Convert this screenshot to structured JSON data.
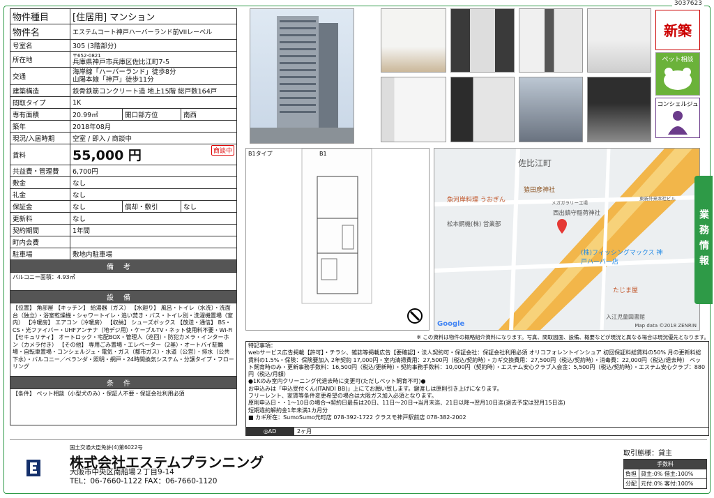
{
  "doc_id": "3037623",
  "spec": {
    "type_k": "物件種目",
    "type_v": "[住居用] マンション",
    "name_k": "物件名",
    "name_v": "エステムコート神戸ハーバーランド前VIIレーベル",
    "room_k": "号室名",
    "room_v": "305 (3階部分)",
    "addr_k": "所在地",
    "addr_zip": "〒652-0821",
    "addr_v": "兵庫県神戸市兵庫区佐比江町7-5",
    "access_k": "交通",
    "access_1": "海岸線「ハーバーランド」徒歩8分",
    "access_2": "山陽本線「神戸」徒歩11分",
    "struct_k": "建築構造",
    "struct_v": "鉄骨鉄筋コンクリート造 地上15階 総戸数164戸",
    "layout_k": "間取タイプ",
    "layout_v": "1K",
    "area_k": "専有面積",
    "area_v": "20.99㎡",
    "dir_k": "開口部方位",
    "dir_v": "南西",
    "built_k": "築年",
    "built_v": "2018年08月",
    "status_k": "現況/入居時期",
    "status_v": "空室 / 即入 / 商談中",
    "rent_k": "賃料",
    "rent_v": "55,000 円",
    "rent_tag": "商談中",
    "fee_k": "共益費・管理費",
    "fee_v": "6,700円",
    "deposit_k": "敷金",
    "deposit_v": "なし",
    "key_k": "礼金",
    "key_v": "なし",
    "guar_k": "保証金",
    "guar_v": "なし",
    "amort_k": "償却・敷引",
    "amort_v": "なし",
    "renew_k": "更新料",
    "renew_v": "なし",
    "term_k": "契約期間",
    "term_v": "1年間",
    "town_k": "町内会費",
    "town_v": "",
    "park_k": "駐車場",
    "park_v": "敷地内駐車場",
    "remarks_h": "備考",
    "remarks_v": "バルコニー面積：4.93㎡",
    "equip_h": "設備",
    "equip_v": "【位置】 角部屋 【キッチン】 給湯器（ガス） 【水廻り】 風呂・トイレ（水洗）・洗面台（独立）・浴室乾燥機・シャワートイレ・追い焚き・バス・トイレ別・洗濯機置場（室内） 【冷暖房】 エアコン（冷暖房） 【収納】 シューズボックス 【放送・通信】 BS・CS・光ファイバー・UHFアンテナ（地デジ用）・ケーブルTV・ネット使用料不要・Wi-Fi 【セキュリティ】 オートロック・宅配BOX・管理人（巡回）・防犯カメラ・インターホン（カメラ付き） 【その他】 専用ごみ置場・エレベーター（2基）・オートバイ駐輪場・自転車置場・コンシェルジュ・電気・ガス（都市ガス）・水道（公営）・排水（公共下水）・バルコニー／ベランダ・照明・網戸・24時間換気システム・分譲タイプ・フローリング",
    "cond_h": "条件",
    "cond_v": "【条件】 ペット相談（小型犬のみ）・保証人不要・保証会社利用必須"
  },
  "badges": {
    "new": "新築",
    "pet": "ペット相談",
    "concierge": "コンシェルジュ"
  },
  "floor_label": "B1タイプ",
  "map": {
    "labels": [
      "佐比江町",
      "猿田彦神社",
      "魚河岸料理 うおぎん",
      "メガガラリー工場",
      "西出鎮守稲荷神社",
      "東新外来本社ビル",
      "松本鋼機(株) 営業部",
      "(株)フィッシングマックス 神戸ハーバー店",
      "たじま屋",
      "入江児童図書館",
      "Google",
      "Map data ©2018 ZENRIN"
    ]
  },
  "note": "※ この資料は物件の概略紹介資料になります。写真、間取図面、設備、概要などが現況と異なる場合は現況優先となります。",
  "tokki": [
    "特記事項：",
    "webサービス広告掲載【許可】・チラシ、雑誌等掲載広告【要確認】・法人契約可・保証会社：保証会社利用必須 オリコフォレントインシュア 初回保証料総賃料の50% 月の更新料総賃料の1.5%・保険：保険要加入 2年契約 17,000円・室内清掃費用：27,500円（税込/契約時）・カギ交換費用：27,500円（税込/契約時）・消毒費：22,000円（税込/退去時） ペット飼育時のみ・更新事務手数料：16,500円（税込/更新時）・契約事務手数料：10,000円（契約時）・エステム安心クラブ入会金：5,500円（税込/契約時）・エステム安心クラブ：880円（税込/月額）",
    "●1Kのみ室内クリーニング代退去時に変更可(ただしペット飼育不可)●",
    "お申込みは「申込受付くん(ITANDI BB)」上にてお願い致します。鍵渡しは原則引き上げになります。",
    "フリーレント、家賃等条件変更希望の場合は大阪ガス加入必須となります。",
    "原則申込日・・1～10日の場合→契約日最長は20日、11日～20日→当月末迄、21日以降→翌月10日迄(退去予定は翌月15日迄)",
    "短期違約解約金1年未満1カ月分",
    "■ カギ所在：SumoSumo元町店 078-392-1722 クラスモ神戸駅前店 078-382-2002"
  ],
  "ad": {
    "label": "◎AD",
    "value": "2ヶ月"
  },
  "side_tab": "業務情報",
  "company": {
    "license": "国土交通大臣免許(4)第6022号",
    "name": "株式会社エステムプランニング",
    "address": "大阪市中央区南船場２丁目9-14",
    "tel": "TEL：06-7660-1122 FAX：06-7660-1120"
  },
  "deal": {
    "title": "取引態様：貸主",
    "fee_h": "手数料",
    "r1_k": "負担",
    "r1_v": "貸主:0% 借主:100%",
    "r2_k": "分配",
    "r2_v": "元付:0% 客付:100%"
  }
}
